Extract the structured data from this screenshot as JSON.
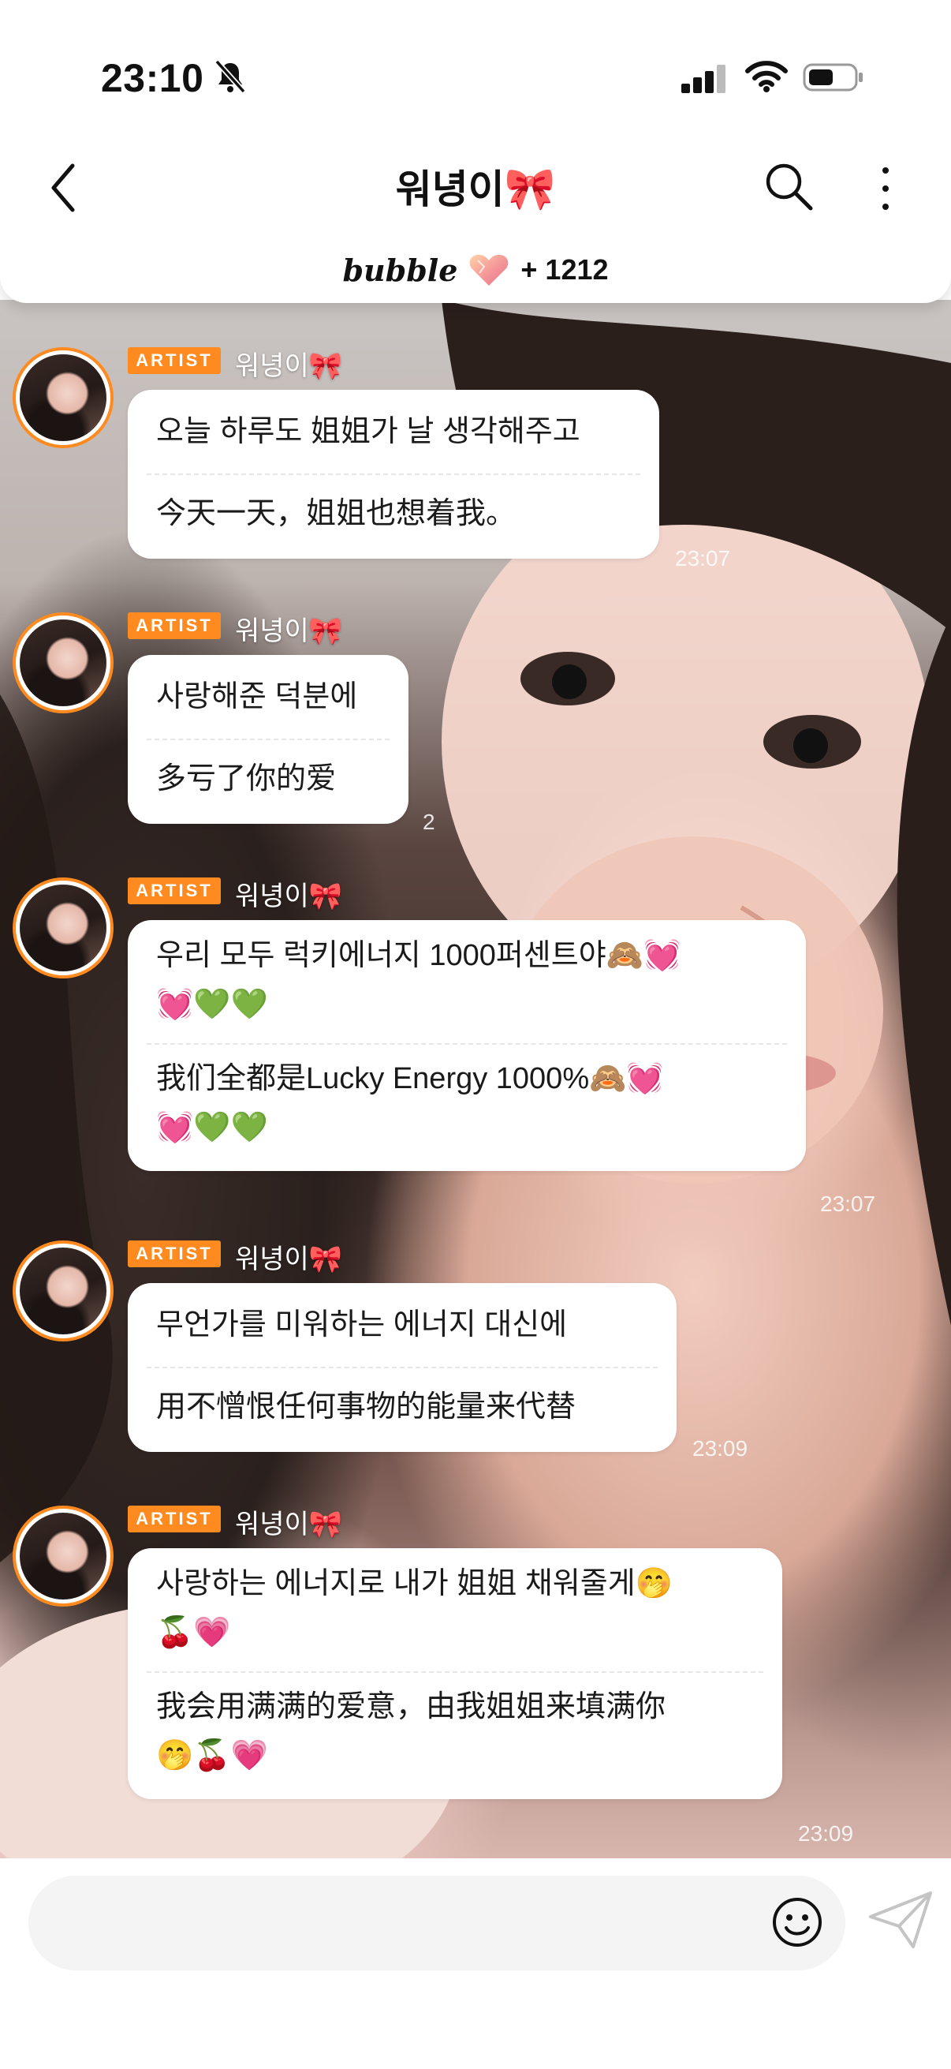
{
  "status_bar": {
    "time": "23:10"
  },
  "header": {
    "title": "워녕이",
    "title_emoji": "🎀"
  },
  "bubble_bar": {
    "logo": "bubble",
    "count": "+ 1212"
  },
  "messages": [
    {
      "badge": "ARTIST",
      "sender": "워녕이🎀",
      "lines": [
        "오늘 하루도 姐姐가 날 생각해주고",
        "今天一天，姐姐也想着我。"
      ],
      "time": "23:07"
    },
    {
      "badge": "ARTIST",
      "sender": "워녕이🎀",
      "lines": [
        "사랑해준 덕분에",
        "多亏了你的爱"
      ],
      "time": "2"
    },
    {
      "badge": "ARTIST",
      "sender": "워녕이🎀",
      "lines": [
        "우리 모두 럭키에너지 1000퍼센트야🙈💓",
        "💓💚💚",
        "我们全都是Lucky Energy 1000%🙈💓",
        "💓💚💚"
      ],
      "time": "23:07"
    },
    {
      "badge": "ARTIST",
      "sender": "워녕이🎀",
      "lines": [
        "무언가를 미워하는 에너지 대신에",
        "用不憎恨任何事物的能量来代替"
      ],
      "time": "23:09"
    },
    {
      "badge": "ARTIST",
      "sender": "워녕이🎀",
      "lines": [
        "사랑하는 에너지로 내가 姐姐 채워줄게🤭",
        "🍒💗",
        "我会用满满的爱意，由我姐姐来填满你",
        "🤭🍒💗"
      ],
      "time": "23:09"
    }
  ],
  "colors": {
    "accent": "#ff8a1f",
    "card": "#ffffff",
    "input_bg": "#f4f4f4"
  }
}
